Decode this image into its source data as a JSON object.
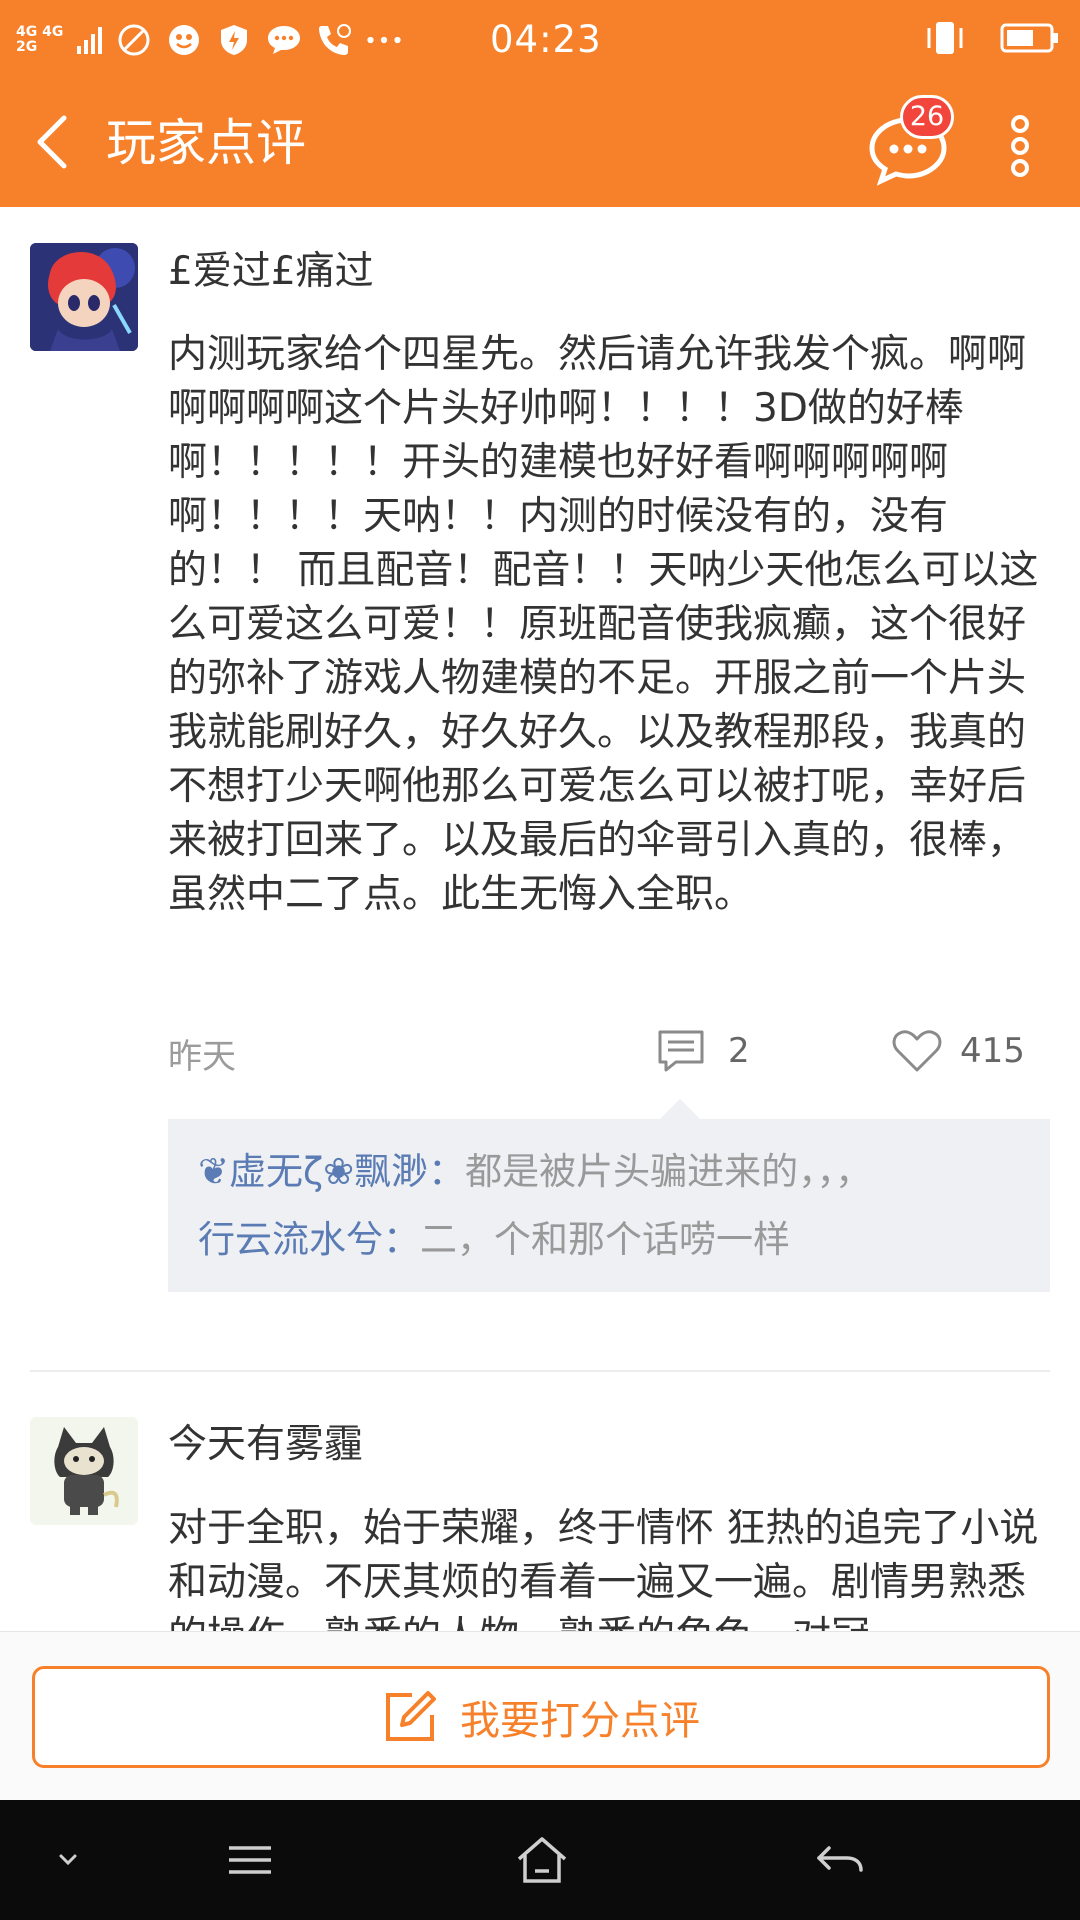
{
  "status_bar": {
    "network_1": "4G 4G",
    "network_2": "2G",
    "time": "04:23"
  },
  "app_bar": {
    "title": "玩家点评",
    "message_badge": "26"
  },
  "reviews": [
    {
      "username": "£爱过£痛过",
      "text": "内测玩家给个四星先。然后请允许我发个疯。啊啊啊啊啊啊这个片头好帅啊！！！！3D做的好棒啊！！！！！开头的建模也好好看啊啊啊啊啊啊！！！！天呐！！内测的时候没有的，没有的！！ 而且配音！配音！！天呐少天他怎么可以这么可爱这么可爱！！原班配音使我疯癫，这个很好的弥补了游戏人物建模的不足。开服之前一个片头我就能刷好久，好久好久。以及教程那段，我真的不想打少天啊他那么可爱怎么可以被打呢，幸好后来被打回来了。以及最后的伞哥引入真的，很棒，虽然中二了点。此生无悔入全职。",
      "date": "昨天",
      "comment_count": "2",
      "like_count": "415",
      "replies": [
        {
          "user": "❦虚无ζ❀飘渺：",
          "text": "都是被片头骗进来的，，，"
        },
        {
          "user": "行云流水兮：",
          "text": "二，个和那个话唠一样"
        }
      ]
    },
    {
      "username": "今天有雾霾",
      "text": "对于全职，始于荣耀，终于情怀 狂热的追完了小说和动漫。不厌其烦的看着一遍又一遍。剧情男熟悉的操作，熟悉的人物，熟悉的角色，对冠"
    }
  ],
  "bottom": {
    "rate_button_label": "我要打分点评"
  },
  "colors": {
    "accent": "#f7812b",
    "badge": "#f2453b",
    "reply_user": "#5a7bb3"
  }
}
